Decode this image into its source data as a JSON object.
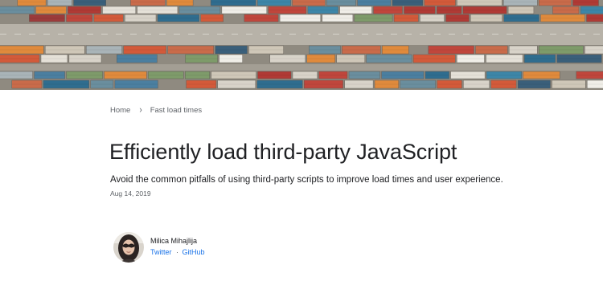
{
  "hero": {
    "alt_icon": "shipping-containers-photo"
  },
  "breadcrumb": {
    "items": [
      "Home",
      "Fast load times"
    ],
    "separator": "›"
  },
  "article": {
    "title": "Efficiently load third-party JavaScript",
    "subtitle": "Avoid the common pitfalls of using third-party scripts to improve load times and user experience.",
    "date": "Aug 14, 2019"
  },
  "author": {
    "name": "Milica Mihajlija",
    "links": [
      "Twitter",
      "GitHub"
    ],
    "link_separator": "·"
  },
  "colors": {
    "link": "#1a73e8",
    "muted": "#5f6368",
    "text": "#202124"
  }
}
